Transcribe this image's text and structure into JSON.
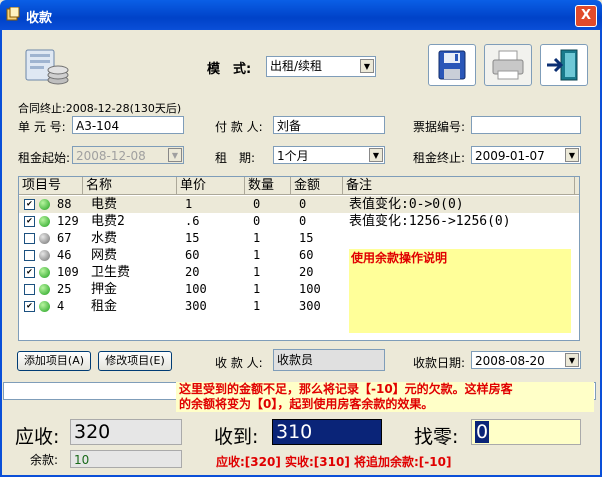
{
  "window": {
    "title": "收款",
    "close_label": "X"
  },
  "mode": {
    "label": "模　式:",
    "value": "出租/续租"
  },
  "toolbar": {
    "save_icon": "floppy-disk-icon",
    "print_icon": "printer-icon",
    "exit_icon": "exit-door-icon"
  },
  "contract_end_note": "合同终止:2008-12-28(130天后)",
  "fields": {
    "unit_label": "单 元 号:",
    "unit_value": "A3-104",
    "payer_label": "付 款 人:",
    "payer_value": "刘备",
    "ticket_label": "票据编号:",
    "ticket_value": "",
    "rent_start_label": "租金起始:",
    "rent_start_value": "2008-12-08",
    "term_label": "租　期:",
    "term_value": "1个月",
    "rent_end_label": "租金终止:",
    "rent_end_value": "2009-01-07"
  },
  "table": {
    "columns": [
      "项目号",
      "名称",
      "单价",
      "数量",
      "金额",
      "备注"
    ],
    "rows": [
      {
        "checked": true,
        "status": "green",
        "id": "88",
        "name": "电费",
        "price": "1",
        "qty": "0",
        "amount": "0",
        "note": "表值变化:0->0(0)"
      },
      {
        "checked": true,
        "status": "green",
        "id": "129",
        "name": "电费2",
        "price": ".6",
        "qty": "0",
        "amount": "0",
        "note": "表值变化:1256->1256(0)"
      },
      {
        "checked": false,
        "status": "grey",
        "id": "67",
        "name": "水费",
        "price": "15",
        "qty": "1",
        "amount": "15",
        "note": ""
      },
      {
        "checked": false,
        "status": "grey",
        "id": "46",
        "name": "网费",
        "price": "60",
        "qty": "1",
        "amount": "60",
        "note": ""
      },
      {
        "checked": true,
        "status": "green",
        "id": "109",
        "name": "卫生费",
        "price": "20",
        "qty": "1",
        "amount": "20",
        "note": ""
      },
      {
        "checked": false,
        "status": "green",
        "id": "25",
        "name": "押金",
        "price": "100",
        "qty": "1",
        "amount": "100",
        "note": ""
      },
      {
        "checked": true,
        "status": "green",
        "id": "4",
        "name": "租金",
        "price": "300",
        "qty": "1",
        "amount": "300",
        "note": ""
      }
    ],
    "balance_help_title": "使用余款操作说明"
  },
  "buttons": {
    "add_item": "添加项目(A)",
    "edit_item": "修改项目(E)"
  },
  "collector": {
    "label": "收 款 人:",
    "value": "收款员"
  },
  "collect_date": {
    "label": "收款日期:",
    "value": "2008-08-20"
  },
  "hint": {
    "line1": "这里受到的金额不足，那么将记录【-10】元的欠款。这样房客",
    "line2": "的余额将变为【0】，起到使用房客余款的效果。"
  },
  "summary": {
    "due_label": "应收:",
    "due_value": "320",
    "received_label": "收到:",
    "received_value": "310",
    "change_label": "找零:",
    "change_value": "0",
    "balance_label": "余款:",
    "balance_value": "10",
    "result_text": "应收:[320] 实收:[310] 将追加余款:[-10]"
  },
  "colors": {
    "titlebar": "#0a4fd8",
    "hint_text": "#e00000",
    "received_bg": "#0a2478",
    "yellow": "#ffff99"
  }
}
